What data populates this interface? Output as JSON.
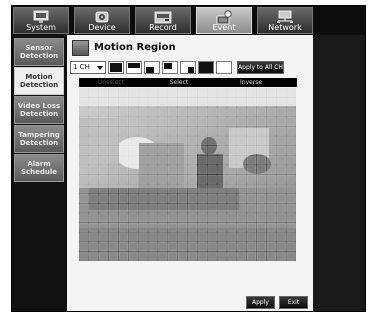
{
  "top_tabs": [
    {
      "label": "System",
      "icon": "monitor-icon",
      "active": false
    },
    {
      "label": "Device",
      "icon": "camera-icon",
      "active": false
    },
    {
      "label": "Record",
      "icon": "recorder-icon",
      "active": false
    },
    {
      "label": "Event",
      "icon": "event-icon",
      "active": true
    },
    {
      "label": "Network",
      "icon": "network-icon",
      "active": false
    }
  ],
  "sidebar": [
    {
      "label": "Sensor Detection",
      "active": false
    },
    {
      "label": "Motion Detection",
      "active": true
    },
    {
      "label": "Video Loss Detection",
      "active": false
    },
    {
      "label": "Tampering Detection",
      "active": false
    },
    {
      "label": "Alarm Schedule",
      "active": false
    }
  ],
  "panel": {
    "title": "Motion Region",
    "channel": "1 CH",
    "apply_all": "Apply to All CH",
    "modes": [
      {
        "label": "Unselect",
        "enabled": false
      },
      {
        "label": "Select",
        "enabled": true
      },
      {
        "label": "Inverse",
        "enabled": true
      }
    ]
  },
  "footer": {
    "apply": "Apply",
    "exit": "Exit"
  }
}
